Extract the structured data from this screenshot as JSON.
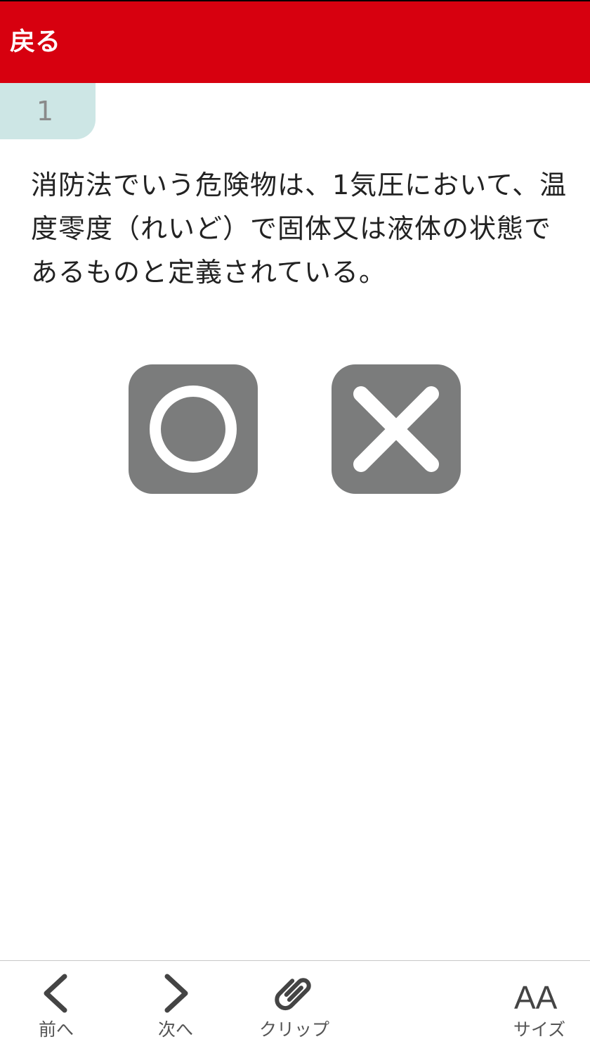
{
  "header": {
    "back_label": "戻る",
    "bar_color": "#d7000f"
  },
  "question": {
    "number": "1",
    "text": "消防法でいう危険物は、1気圧において、温度零度（れいど）で固体又は液体の状態であるものと定義されている。"
  },
  "answers": {
    "correct_icon": "circle-icon",
    "wrong_icon": "cross-icon",
    "button_color": "#7b7c7c"
  },
  "toolbar": {
    "prev_label": "前へ",
    "next_label": "次へ",
    "clip_label": "クリップ",
    "size_label": "サイズ",
    "prev_icon": "chevron-left-icon",
    "next_icon": "chevron-right-icon",
    "clip_icon": "paperclip-icon",
    "size_icon": "font-size-icon",
    "size_icon_text": "AA"
  }
}
